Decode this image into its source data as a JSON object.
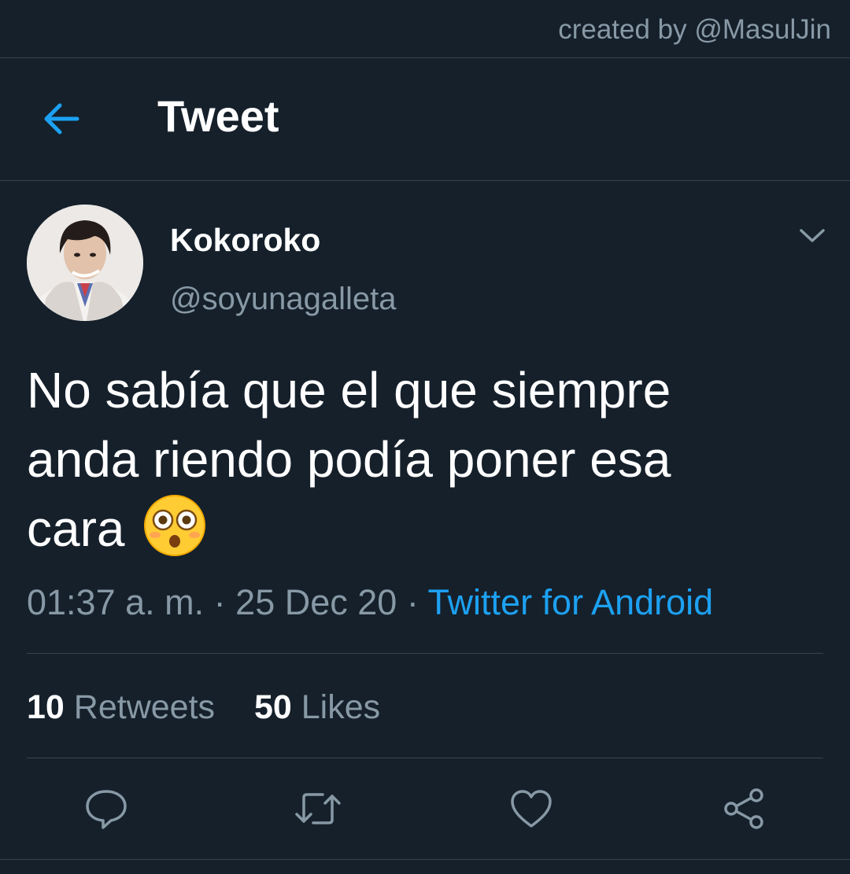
{
  "watermark": {
    "text": "created by @MasulJin"
  },
  "header": {
    "title": "Tweet",
    "back_icon": "arrow-left-icon"
  },
  "tweet": {
    "author": {
      "display_name": "Kokoroko",
      "handle": "@soyunagalleta"
    },
    "text": "No sabía que el que siempre anda riendo podía poner esa cara",
    "emoji": "flushed-face",
    "time": "01:37 a. m.",
    "date": "25 Dec 20",
    "separator": "·",
    "source": "Twitter for Android",
    "stats": {
      "retweets_count": "10",
      "retweets_label": "Retweets",
      "likes_count": "50",
      "likes_label": "Likes"
    },
    "actions": [
      "reply-icon",
      "retweet-icon",
      "like-icon",
      "share-icon"
    ]
  },
  "colors": {
    "background": "#15202b",
    "divider": "#38444d",
    "accent": "#1da1f2",
    "secondary_text": "#8899a6"
  }
}
